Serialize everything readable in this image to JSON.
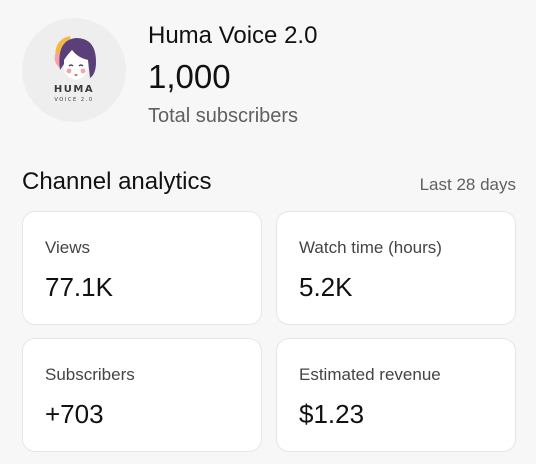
{
  "channel": {
    "avatar_brand_name": "HUMA",
    "avatar_brand_sub": "VOICE 2.0",
    "name": "Huma Voice 2.0",
    "subscriber_count": "1,000",
    "subscriber_label": "Total subscribers"
  },
  "analytics": {
    "title": "Channel analytics",
    "period": "Last 28 days",
    "cards": [
      {
        "label": "Views",
        "value": "77.1K"
      },
      {
        "label": "Watch time (hours)",
        "value": "5.2K"
      },
      {
        "label": "Subscribers",
        "value": "+703"
      },
      {
        "label": "Estimated revenue",
        "value": "$1.23"
      }
    ]
  },
  "colors": {
    "background": "#f7f7f7",
    "card_background": "#ffffff",
    "primary_text": "#111111",
    "secondary_text": "#606060",
    "avatar_hair": "#5a3f78",
    "avatar_accent_yellow": "#f2b844",
    "avatar_accent_pink": "#f7a1ab"
  }
}
